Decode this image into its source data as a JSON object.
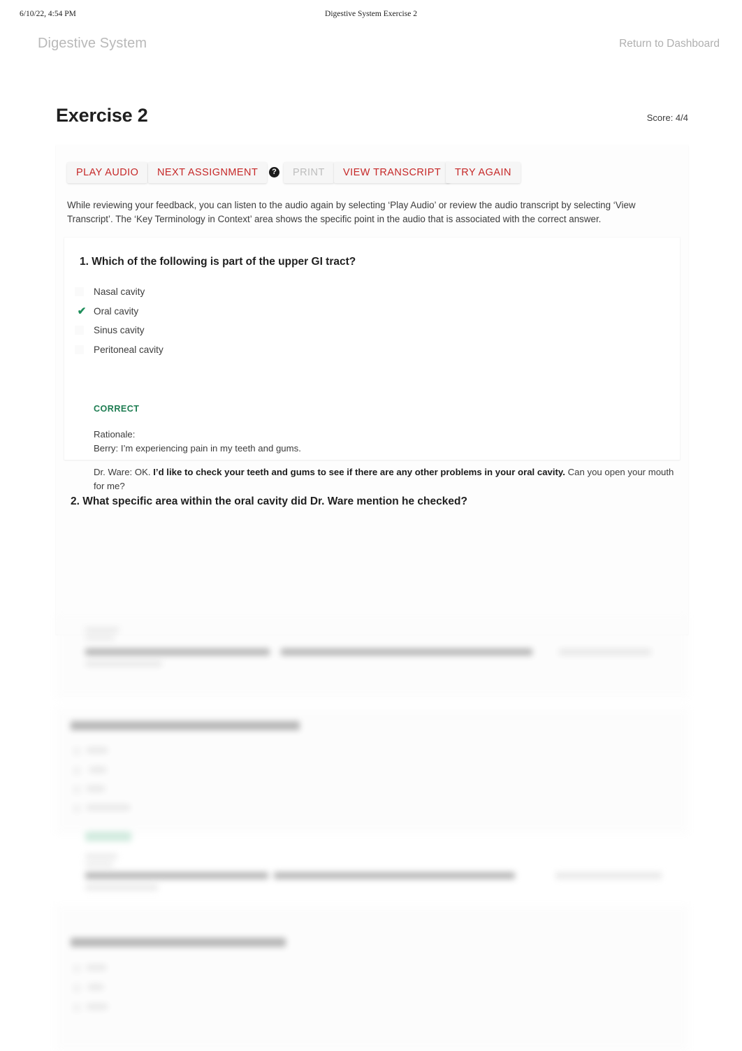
{
  "print_header": {
    "timestamp": "6/10/22, 4:54 PM",
    "document_title": "Digestive System Exercise 2"
  },
  "appbar": {
    "app_title": "Digestive System",
    "dashboard_link": "Return to Dashboard"
  },
  "page": {
    "title": "Exercise 2",
    "score_label": "Score: 4/4"
  },
  "toolbar": {
    "play_audio": "PLAY AUDIO",
    "next_assignment": "NEXT ASSIGNMENT",
    "help_icon": "?",
    "print": "PRINT",
    "view_transcript": "VIEW TRANSCRIPT",
    "try_again": "TRY AGAIN"
  },
  "instructions": {
    "line1": "While reviewing your feedback, you can listen to the audio again by selecting ‘Play Audio’ or review the audio transcript by selecting ‘View Transcript’.",
    "line2": "The ‘Key Terminology in Context’ area shows the specific point in the audio that is associated with the correct answer."
  },
  "questions": [
    {
      "number": "1.",
      "text": "1. Which of the following is part of the upper GI tract?",
      "options": [
        {
          "label": "Nasal cavity",
          "selected": false
        },
        {
          "label": "Oral cavity",
          "selected": true
        },
        {
          "label": "Sinus cavity",
          "selected": false
        },
        {
          "label": "Peritoneal cavity",
          "selected": false
        }
      ],
      "verdict": "CORRECT",
      "rationale_label": "Rationale:",
      "rationale_line1": "Berry: I’m experiencing pain in my teeth and gums.",
      "rationale_line2_pre": "Dr. Ware: OK. ",
      "rationale_line2_bold": "I’d like to check your teeth and gums to see if there are any other problems in your oral cavity.",
      "rationale_line2_post": " Can you open your mouth for me?"
    },
    {
      "number": "2.",
      "text": "2. What specific area within the oral cavity did Dr. Ware mention he checked?"
    }
  ],
  "colors": {
    "accent_red": "#c62828",
    "correct_green": "#1e7d52",
    "muted_gray": "#b9b9b9",
    "text_dark": "#1f1f1f"
  }
}
